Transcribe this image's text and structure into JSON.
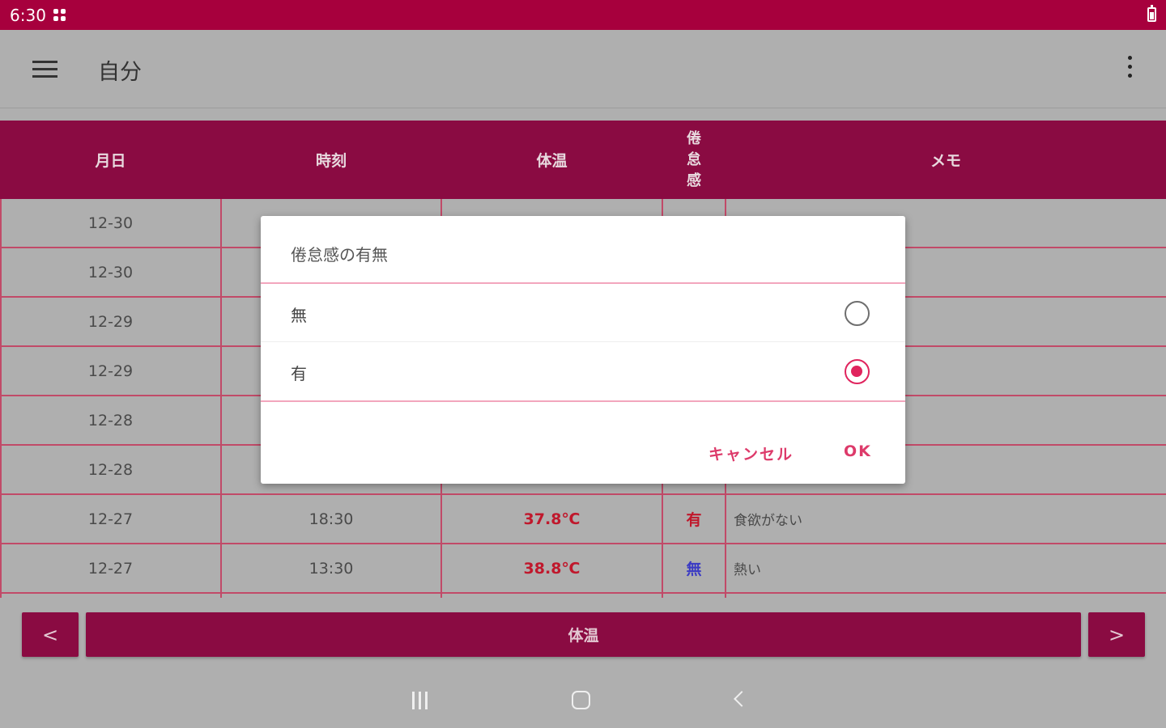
{
  "status_bar": {
    "time": "6:30",
    "icons": [
      "grid-dots-icon",
      "battery-icon"
    ]
  },
  "app_bar": {
    "menu_icon": "hamburger-menu-icon",
    "title": "自分",
    "more_icon": "more-vertical-icon"
  },
  "table": {
    "headers": {
      "date": "月日",
      "time": "時刻",
      "temp": "体温",
      "fatigue": [
        "倦",
        "怠",
        "感"
      ],
      "memo": "メモ"
    },
    "rows": [
      {
        "date": "12-30",
        "time": "",
        "temp": "",
        "fatigue": "",
        "memo": ""
      },
      {
        "date": "12-30",
        "time": "",
        "temp": "",
        "fatigue": "",
        "memo": ""
      },
      {
        "date": "12-29",
        "time": "",
        "temp": "",
        "fatigue": "",
        "memo": ""
      },
      {
        "date": "12-29",
        "time": "",
        "temp": "",
        "fatigue": "",
        "memo": ""
      },
      {
        "date": "12-28",
        "time": "",
        "temp": "",
        "fatigue": "",
        "memo": ""
      },
      {
        "date": "12-28",
        "time": "",
        "temp": "",
        "fatigue": "",
        "memo": ""
      },
      {
        "date": "12-27",
        "time": "18:30",
        "temp": "37.8℃",
        "fatigue": "有",
        "memo": "食欲がない"
      },
      {
        "date": "12-27",
        "time": "13:30",
        "temp": "38.8℃",
        "fatigue": "無",
        "memo": "熱い"
      }
    ]
  },
  "dialog": {
    "title": "倦怠感の有無",
    "options": [
      {
        "label": "無",
        "checked": false
      },
      {
        "label": "有",
        "checked": true
      }
    ],
    "cancel_label": "キャンセル",
    "ok_label": "OK",
    "accent_color": "#e0245e"
  },
  "bottom_bar": {
    "prev_label": "<",
    "main_label": "体温",
    "next_label": ">"
  },
  "system_nav": {
    "icons": [
      "recents-icon",
      "home-icon",
      "back-icon"
    ]
  },
  "colors": {
    "status_bar": "#a7003d",
    "primary": "#8a0b42",
    "grid_line": "#c14a68",
    "scrim": "#afafaf"
  }
}
